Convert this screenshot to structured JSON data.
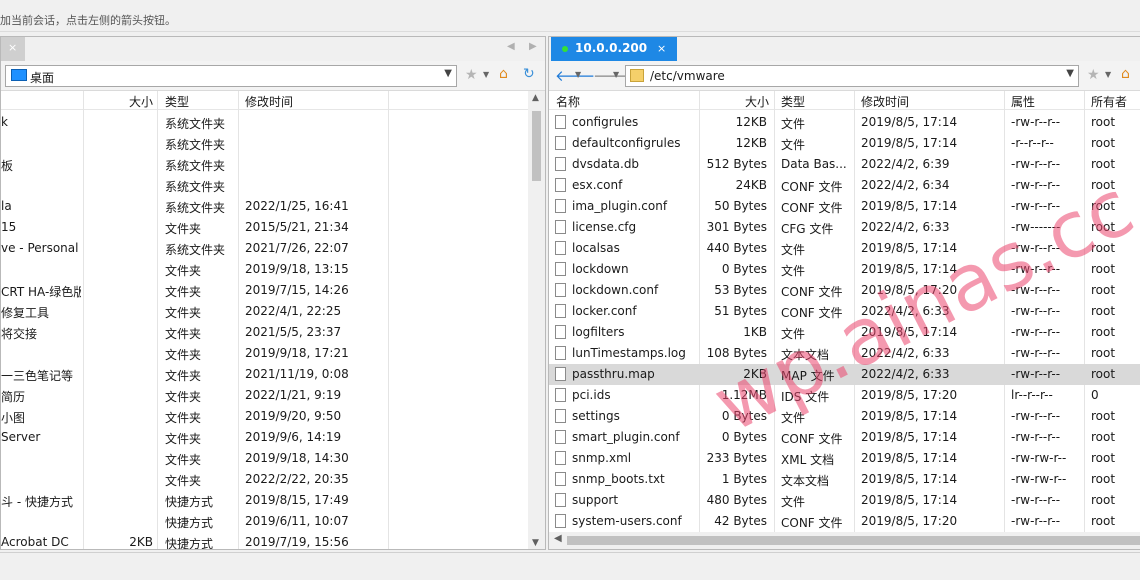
{
  "hint_text": "加当前会话，点击左侧的箭头按钮。",
  "left_pane": {
    "tab_close": "×",
    "path": "桌面",
    "columns": {
      "size": "大小",
      "type": "类型",
      "modified": "修改时间"
    },
    "rows": [
      {
        "name": "k",
        "size": "",
        "type": "系统文件夹",
        "modified": ""
      },
      {
        "name": "",
        "size": "",
        "type": "系统文件夹",
        "modified": ""
      },
      {
        "name": "板",
        "size": "",
        "type": "系统文件夹",
        "modified": ""
      },
      {
        "name": "",
        "size": "",
        "type": "系统文件夹",
        "modified": ""
      },
      {
        "name": "la",
        "size": "",
        "type": "系统文件夹",
        "modified": "2022/1/25, 16:41"
      },
      {
        "name": "15",
        "size": "",
        "type": "文件夹",
        "modified": "2015/5/21, 21:34"
      },
      {
        "name": "ve - Personal",
        "size": "",
        "type": "系统文件夹",
        "modified": "2021/7/26, 22:07"
      },
      {
        "name": "",
        "size": "",
        "type": "文件夹",
        "modified": "2019/9/18, 13:15"
      },
      {
        "name": "CRT HA-绿色版",
        "size": "",
        "type": "文件夹",
        "modified": "2019/7/15, 14:26"
      },
      {
        "name": "修复工具",
        "size": "",
        "type": "文件夹",
        "modified": "2022/4/1, 22:25"
      },
      {
        "name": "将交接",
        "size": "",
        "type": "文件夹",
        "modified": "2021/5/5, 23:37"
      },
      {
        "name": "",
        "size": "",
        "type": "文件夹",
        "modified": "2019/9/18, 17:21"
      },
      {
        "name": "一三色笔记等",
        "size": "",
        "type": "文件夹",
        "modified": "2021/11/19, 0:08"
      },
      {
        "name": "简历",
        "size": "",
        "type": "文件夹",
        "modified": "2022/1/21, 9:19"
      },
      {
        "name": "小图",
        "size": "",
        "type": "文件夹",
        "modified": "2019/9/20, 9:50"
      },
      {
        "name": "Server",
        "size": "",
        "type": "文件夹",
        "modified": "2019/9/6, 14:19"
      },
      {
        "name": "",
        "size": "",
        "type": "文件夹",
        "modified": "2019/9/18, 14:30"
      },
      {
        "name": "",
        "size": "",
        "type": "文件夹",
        "modified": "2022/2/22, 20:35"
      },
      {
        "name": "斗 - 快捷方式",
        "size": "",
        "type": "快捷方式",
        "modified": "2019/8/15, 17:49"
      },
      {
        "name": "",
        "size": "",
        "type": "快捷方式",
        "modified": "2019/6/11, 10:07"
      },
      {
        "name": "Acrobat DC",
        "size": "2KB",
        "type": "快捷方式",
        "modified": "2019/7/19, 15:56"
      }
    ]
  },
  "right_pane": {
    "tab_title": "10.0.0.200",
    "tab_close": "×",
    "path": "/etc/vmware",
    "columns": {
      "name": "名称",
      "size": "大小",
      "type": "类型",
      "modified": "修改时间",
      "perms": "属性",
      "owner": "所有者"
    },
    "selected_index": 12,
    "rows": [
      {
        "name": "configrules",
        "size": "12KB",
        "type": "文件",
        "modified": "2019/8/5, 17:14",
        "perms": "-rw-r--r--",
        "owner": "root"
      },
      {
        "name": "defaultconfigrules",
        "size": "12KB",
        "type": "文件",
        "modified": "2019/8/5, 17:14",
        "perms": "-r--r--r--",
        "owner": "root"
      },
      {
        "name": "dvsdata.db",
        "size": "512 Bytes",
        "type": "Data Bas...",
        "modified": "2022/4/2, 6:39",
        "perms": "-rw-r--r--",
        "owner": "root"
      },
      {
        "name": "esx.conf",
        "size": "24KB",
        "type": "CONF 文件",
        "modified": "2022/4/2, 6:34",
        "perms": "-rw-r--r--",
        "owner": "root"
      },
      {
        "name": "ima_plugin.conf",
        "size": "50 Bytes",
        "type": "CONF 文件",
        "modified": "2019/8/5, 17:14",
        "perms": "-rw-r--r--",
        "owner": "root"
      },
      {
        "name": "license.cfg",
        "size": "301 Bytes",
        "type": "CFG 文件",
        "modified": "2022/4/2, 6:33",
        "perms": "-rw-------",
        "owner": "root"
      },
      {
        "name": "localsas",
        "size": "440 Bytes",
        "type": "文件",
        "modified": "2019/8/5, 17:14",
        "perms": "-rw-r--r--",
        "owner": "root"
      },
      {
        "name": "lockdown",
        "size": "0 Bytes",
        "type": "文件",
        "modified": "2019/8/5, 17:14",
        "perms": "-rw-r--r--",
        "owner": "root"
      },
      {
        "name": "lockdown.conf",
        "size": "53 Bytes",
        "type": "CONF 文件",
        "modified": "2019/8/5, 17:20",
        "perms": "-rw-r--r--",
        "owner": "root"
      },
      {
        "name": "locker.conf",
        "size": "51 Bytes",
        "type": "CONF 文件",
        "modified": "2022/4/2, 6:33",
        "perms": "-rw-r--r--",
        "owner": "root"
      },
      {
        "name": "logfilters",
        "size": "1KB",
        "type": "文件",
        "modified": "2019/8/5, 17:14",
        "perms": "-rw-r--r--",
        "owner": "root"
      },
      {
        "name": "lunTimestamps.log",
        "size": "108 Bytes",
        "type": "文本文档",
        "modified": "2022/4/2, 6:33",
        "perms": "-rw-r--r--",
        "owner": "root"
      },
      {
        "name": "passthru.map",
        "size": "2KB",
        "type": "MAP 文件",
        "modified": "2022/4/2, 6:33",
        "perms": "-rw-r--r--",
        "owner": "root"
      },
      {
        "name": "pci.ids",
        "size": "1.12MB",
        "type": "IDS 文件",
        "modified": "2019/8/5, 17:20",
        "perms": "lr--r--r--",
        "owner": "0"
      },
      {
        "name": "settings",
        "size": "0 Bytes",
        "type": "文件",
        "modified": "2019/8/5, 17:14",
        "perms": "-rw-r--r--",
        "owner": "root"
      },
      {
        "name": "smart_plugin.conf",
        "size": "0 Bytes",
        "type": "CONF 文件",
        "modified": "2019/8/5, 17:14",
        "perms": "-rw-r--r--",
        "owner": "root"
      },
      {
        "name": "snmp.xml",
        "size": "233 Bytes",
        "type": "XML 文档",
        "modified": "2019/8/5, 17:14",
        "perms": "-rw-rw-r--",
        "owner": "root"
      },
      {
        "name": "snmp_boots.txt",
        "size": "1 Bytes",
        "type": "文本文档",
        "modified": "2019/8/5, 17:14",
        "perms": "-rw-rw-r--",
        "owner": "root"
      },
      {
        "name": "support",
        "size": "480 Bytes",
        "type": "文件",
        "modified": "2019/8/5, 17:14",
        "perms": "-rw-r--r--",
        "owner": "root"
      },
      {
        "name": "system-users.conf",
        "size": "42 Bytes",
        "type": "CONF 文件",
        "modified": "2019/8/5, 17:20",
        "perms": "-rw-r--r--",
        "owner": "root"
      }
    ]
  },
  "watermark": "wp.ainas.cc",
  "icons": {
    "back": "back-arrow-icon",
    "forward": "forward-arrow-icon",
    "folder": "folder-icon",
    "favorite": "star-icon",
    "home": "home-icon",
    "refresh": "refresh-icon"
  },
  "colors": {
    "tab_active": "#1e88e5",
    "connected": "#35e035",
    "selected_row": "#d9d9d9"
  }
}
